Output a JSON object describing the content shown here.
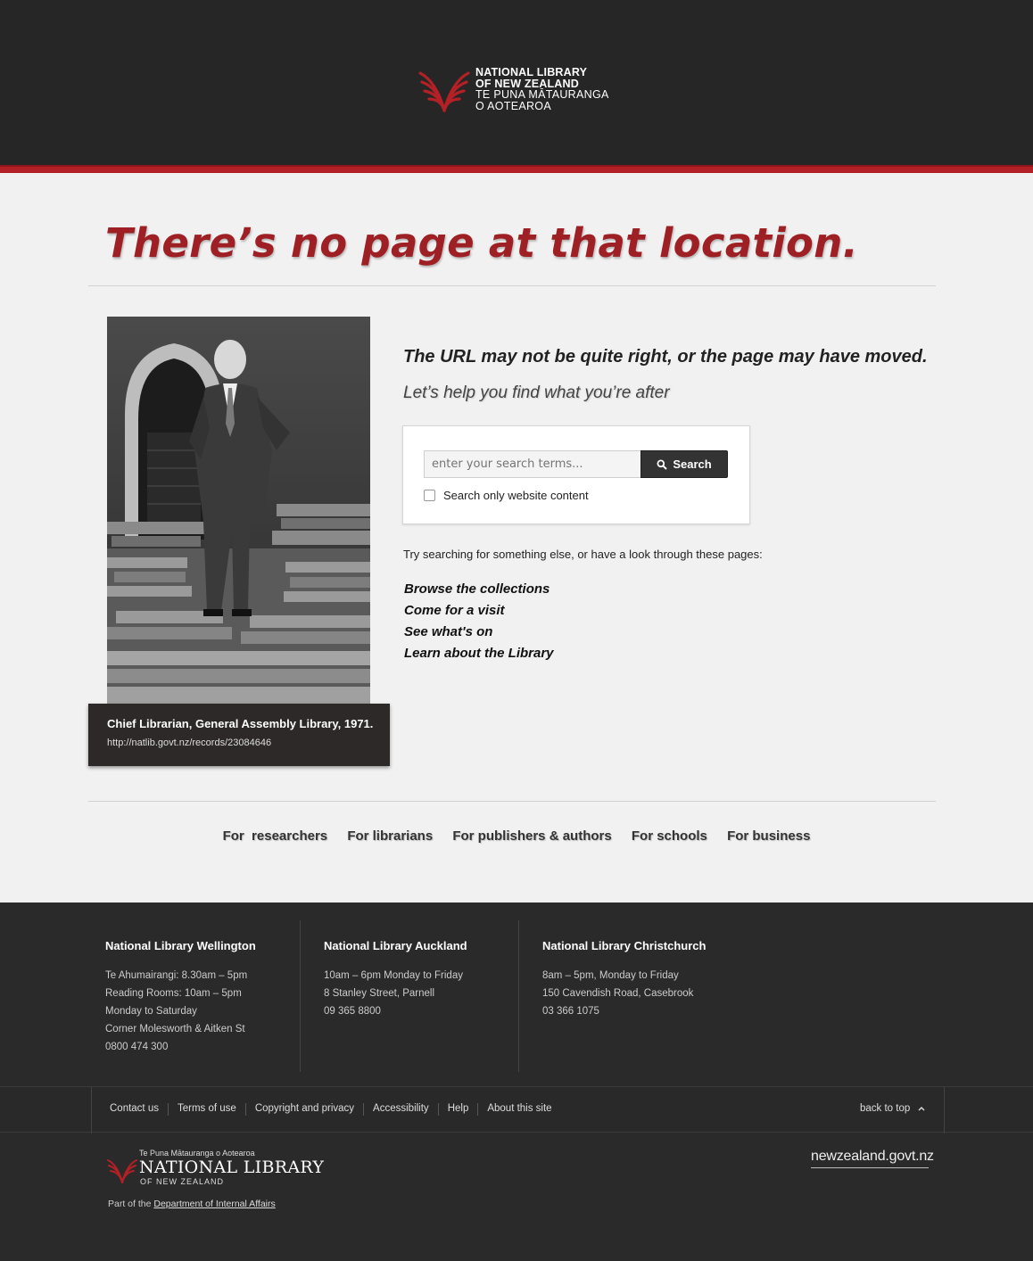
{
  "header": {
    "logo_line1": "NATIONAL LIBRARY",
    "logo_line2": "OF NEW ZEALAND",
    "logo_line3": "TE PUNA MĀTAURANGA",
    "logo_line4": "O AOTEAROA",
    "brand_color": "#b32025"
  },
  "main": {
    "headline": "There’s no page at that location.",
    "subheading": "The URL may not be quite right, or the page may have moved.",
    "help_text": "Let’s help you find what you’re after",
    "search": {
      "placeholder": "enter your search terms...",
      "button_label": "Search",
      "checkbox_label": "Search only website content"
    },
    "try_text": "Try searching for something else, or have a look through these pages:",
    "links": [
      "Browse the collections",
      "Come for a visit",
      "See what's on",
      "Learn about the Library"
    ],
    "photo": {
      "caption_title": "Chief Librarian, General Assembly Library, 1971.",
      "caption_url": "http://natlib.govt.nz/records/23084646"
    },
    "audiences": [
      "For  researchers",
      "For librarians",
      "For publishers & authors",
      "For schools",
      "For business"
    ]
  },
  "footer": {
    "locations": [
      {
        "name": "National Library Wellington",
        "lines": [
          "Te Ahumairangi: 8.30am – 5pm",
          "Reading Rooms: 10am – 5pm",
          "Monday to Saturday",
          "Corner Molesworth & Aitken St",
          "0800 474 300"
        ]
      },
      {
        "name": "National Library Auckland",
        "lines": [
          "10am – 6pm Monday to Friday",
          "8 Stanley Street, Parnell",
          "09 365 8800"
        ]
      },
      {
        "name": "National Library Christchurch",
        "lines": [
          "8am – 5pm, Monday to Friday",
          "150 Cavendish Road, Casebrook",
          "03 366 1075"
        ]
      }
    ],
    "nav": [
      "Contact us",
      "Terms of use",
      "Copyright and privacy",
      "Accessibility",
      "Help",
      "About this site"
    ],
    "back_to_top": "back to top",
    "logo_top": "Te Puna Mātauranga o Aotearoa",
    "logo_name": "NATIONAL LIBRARY",
    "logo_sub": "OF NEW ZEALAND",
    "part_of_prefix": "Part of the",
    "part_of_link": "Department of Internal Affairs",
    "govt_link": "newzealand.govt.nz"
  }
}
